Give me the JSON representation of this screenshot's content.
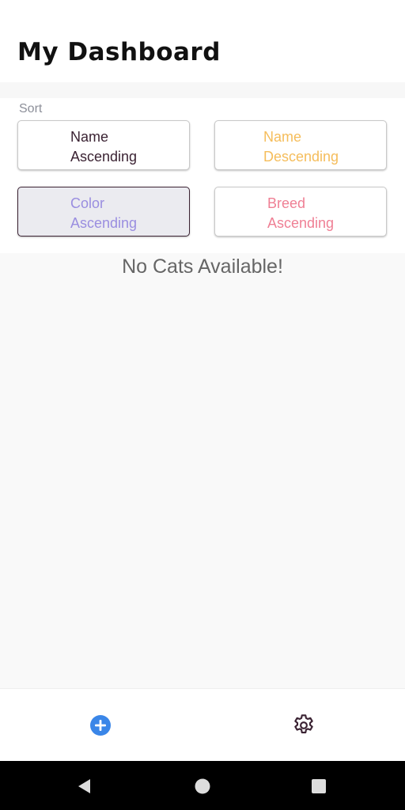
{
  "header": {
    "title": "My Dashboard"
  },
  "sort": {
    "label": "Sort",
    "options": [
      {
        "label": "Name\nAscending",
        "color": "#3b2333",
        "active": false
      },
      {
        "label": "Name\nDescending",
        "color": "#f5bd5b",
        "active": false
      },
      {
        "label": "Color\nAscending",
        "color": "#9a8ee0",
        "active": true
      },
      {
        "label": "Breed\nAscending",
        "color": "#ef7f94",
        "active": false
      }
    ]
  },
  "content": {
    "empty_message": "No Cats Available!"
  },
  "bottom_nav": {
    "add_icon": "plus-circle-icon",
    "settings_icon": "gear-icon",
    "accent_color": "#3a86e8",
    "settings_color": "#3b2333"
  },
  "system_nav": {
    "back": "back-icon",
    "home": "home-icon",
    "recents": "recents-icon"
  }
}
